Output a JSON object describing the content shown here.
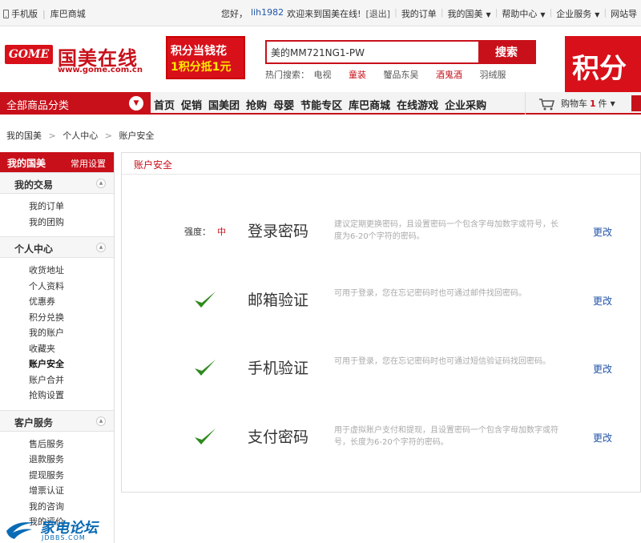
{
  "topbar": {
    "mobile": "手机版",
    "kuba": "库巴商城",
    "greeting": "您好，",
    "username": "lih1982",
    "welcome": "欢迎来到国美在线!",
    "logout": "[退出]",
    "orders": "我的订单",
    "mygome": "我的国美",
    "help": "帮助中心",
    "enterprise": "企业服务",
    "sitenav": "网站导"
  },
  "logo": {
    "badge": "GOME",
    "name": "国美在线",
    "url": "www.gome.com.cn"
  },
  "promo": {
    "line1": "积分当钱花",
    "line2": "1积分抵1元"
  },
  "search": {
    "value": "美的MM721NG1-PW",
    "button": "搜索",
    "hot_label": "热门搜索：",
    "hot": [
      "电视",
      "童装",
      "蟹品东吴",
      "酒鬼酒",
      "羽绒服"
    ]
  },
  "banner": {
    "text": "积分"
  },
  "nav": {
    "all_categories": "全部商品分类",
    "links": [
      "首页",
      "促销",
      "国美团",
      "抢购",
      "母婴",
      "节能专区",
      "库巴商城",
      "在线游戏",
      "企业采购"
    ],
    "cart_label": "购物车",
    "cart_count": "1",
    "cart_unit": "件"
  },
  "breadcrumb": [
    "我的国美",
    "个人中心",
    "账户安全"
  ],
  "sidebar": {
    "title": "我的国美",
    "settings": "常用设置",
    "groups": [
      {
        "title": "我的交易",
        "items": [
          "我的订单",
          "我的团购"
        ]
      },
      {
        "title": "个人中心",
        "items": [
          "收货地址",
          "个人资料",
          "优惠券",
          "积分兑换",
          "我的账户",
          "收藏夹",
          "账户安全",
          "账户合并",
          "抢购设置"
        ]
      },
      {
        "title": "客户服务",
        "items": [
          "售后服务",
          "退款服务",
          "提现服务",
          "增票认证",
          "我的咨询",
          "我的评价"
        ]
      }
    ]
  },
  "main": {
    "title": "账户安全",
    "strength_label": "强度：",
    "strength_value": "中",
    "rows": [
      {
        "name": "登录密码",
        "desc": "建议定期更换密码，且设置密码一个包含字母加数字或符号，长度为6-20个字符的密码。",
        "action": "更改"
      },
      {
        "name": "邮箱验证",
        "desc": "可用于登录，您在忘记密码时也可通过邮件找回密码。",
        "action": "更改"
      },
      {
        "name": "手机验证",
        "desc": "可用于登录，您在忘记密码时也可通过短信验证码找回密码。",
        "action": "更改"
      },
      {
        "name": "支付密码",
        "desc": "用于虚拟账户支付和提现，且设置密码一个包含字母加数字或符号，长度为6-20个字符的密码。",
        "action": "更改"
      }
    ]
  },
  "watermark": {
    "title": "家电论坛",
    "sub": "JDBBS.COM"
  },
  "colors": {
    "brand_red": "#c8101a",
    "link_blue": "#2255aa",
    "check_green": "#2e8b1e"
  }
}
